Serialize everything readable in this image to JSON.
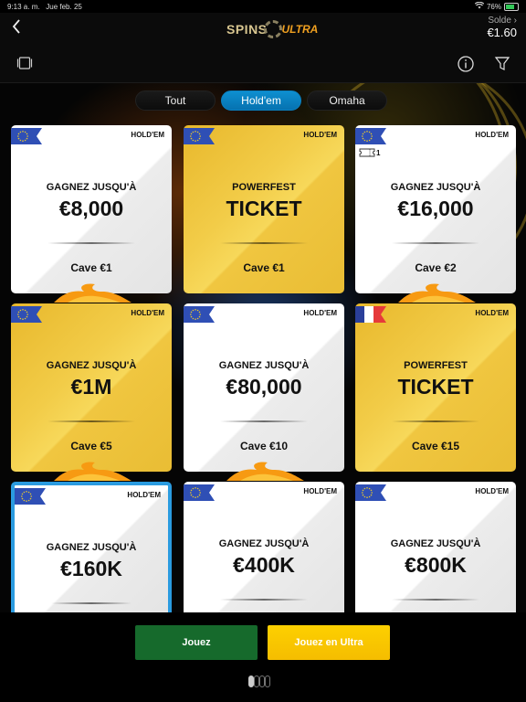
{
  "status_bar": {
    "time": "9:13 a. m.",
    "date": "Jue feb. 25",
    "battery": "76%",
    "battery_level": 0.76
  },
  "header": {
    "logo_text_1": "SPINS",
    "logo_text_2": "ULTRA",
    "balance_label": "Solde ›",
    "balance_value": "€1.60"
  },
  "toolbar": {
    "left_icon": "card-view-icon",
    "info_icon": "info-icon",
    "filter_icon": "filter-icon"
  },
  "tabs": [
    {
      "label": "Tout",
      "active": false
    },
    {
      "label": "Hold'em",
      "active": true
    },
    {
      "label": "Omaha",
      "active": false
    }
  ],
  "cards": [
    {
      "style": "white",
      "flag": "eu",
      "variant": "HOLD'EM",
      "sub": "GAGNEZ JUSQU'À",
      "main": "€8,000",
      "cave": "Cave €1",
      "ticket_count": null,
      "flame": true
    },
    {
      "style": "gold",
      "flag": "eu",
      "variant": "HOLD'EM",
      "sub": "POWERFEST",
      "main": "TICKET",
      "cave": "Cave €1",
      "ticket_count": null,
      "flame": false
    },
    {
      "style": "white",
      "flag": "eu",
      "variant": "HOLD'EM",
      "sub": "GAGNEZ JUSQU'À",
      "main": "€16,000",
      "cave": "Cave €2",
      "ticket_count": "1",
      "flame": true
    },
    {
      "style": "gold",
      "flag": "eu",
      "variant": "HOLD'EM",
      "sub": "GAGNEZ JUSQU'À",
      "main": "€1M",
      "cave": "Cave €5",
      "ticket_count": null,
      "flame": true
    },
    {
      "style": "white",
      "flag": "eu",
      "variant": "HOLD'EM",
      "sub": "GAGNEZ JUSQU'À",
      "main": "€80,000",
      "cave": "Cave €10",
      "ticket_count": null,
      "flame": true
    },
    {
      "style": "gold",
      "flag": "fr",
      "variant": "HOLD'EM",
      "sub": "POWERFEST",
      "main": "TICKET",
      "cave": "Cave €15",
      "ticket_count": null,
      "flame": false
    },
    {
      "style": "white",
      "flag": "eu",
      "variant": "HOLD'EM",
      "sub": "GAGNEZ JUSQU'À",
      "main": "€160K",
      "cave": "",
      "ticket_count": null,
      "flame": false,
      "selected": true
    },
    {
      "style": "white",
      "flag": "eu",
      "variant": "HOLD'EM",
      "sub": "GAGNEZ JUSQU'À",
      "main": "€400K",
      "cave": "",
      "ticket_count": null,
      "flame": false
    },
    {
      "style": "white",
      "flag": "eu",
      "variant": "HOLD'EM",
      "sub": "GAGNEZ JUSQU'À",
      "main": "€800K",
      "cave": "",
      "ticket_count": null,
      "flame": false
    }
  ],
  "actions": {
    "play_label": "Jouez",
    "ultra_label": "Jouez en Ultra"
  },
  "pager": {
    "pages": 4,
    "current": 1
  },
  "colors": {
    "accent_blue": "#0a85c8",
    "play_green": "#166a2c",
    "ultra_yellow": "#f8c600",
    "gold_card": "#f0c640"
  }
}
